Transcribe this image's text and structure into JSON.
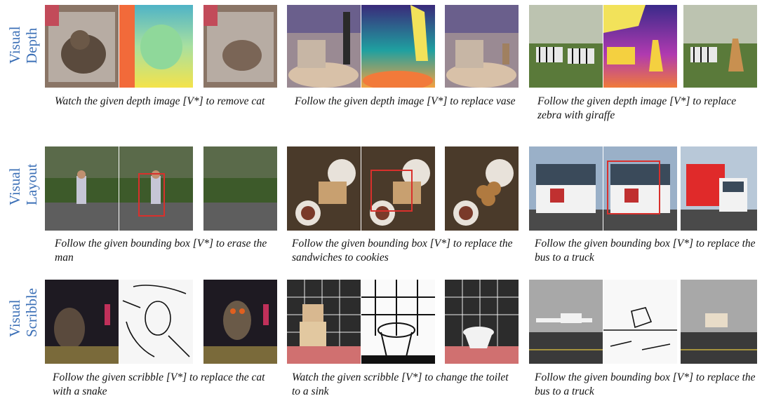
{
  "rows": [
    {
      "label_line1": "Visual",
      "label_line2": "Depth",
      "captions": [
        "Watch the given depth image [V*] to remove cat",
        "Follow the given depth image [V*] to replace vase",
        "Follow the given depth image [V*] to replace zebra with giraffe"
      ]
    },
    {
      "label_line1": "Visual",
      "label_line2": "Layout",
      "captions": [
        "Follow the given bounding box [V*] to erase the man",
        "Follow the given bounding box [V*] to replace the sandwiches to cookies",
        "Follow the given bounding box [V*] to replace the bus to a truck"
      ]
    },
    {
      "label_line1": "Visual",
      "label_line2": "Scribble",
      "captions": [
        "Follow the given scribble [V*] to replace the cat with a snake",
        "Watch the given scribble [V*] to change the toilet to a sink",
        "Follow the given bounding box [V*] to replace the bus to a truck"
      ]
    }
  ]
}
